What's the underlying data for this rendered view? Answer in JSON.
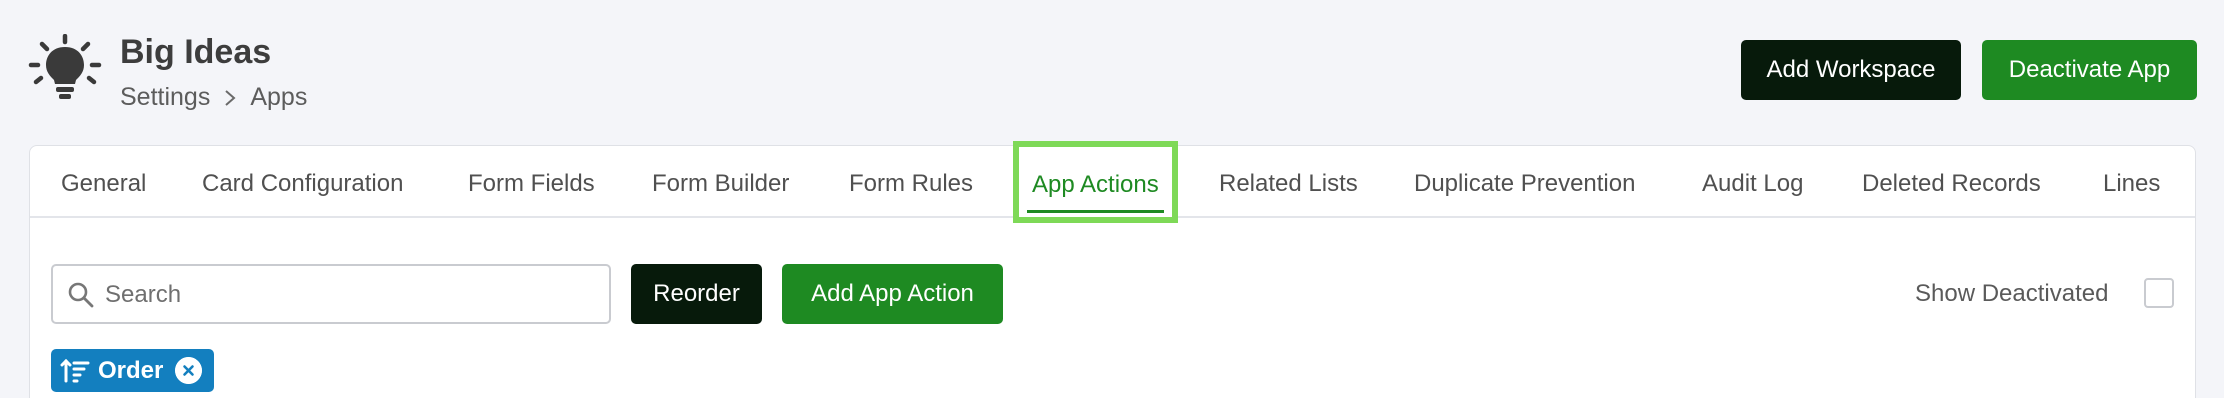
{
  "app": {
    "title": "Big Ideas",
    "icon": "lightbulb-icon"
  },
  "breadcrumb": {
    "items": [
      "Settings",
      "Apps"
    ],
    "separator_icon": "chevron-right-icon"
  },
  "header_actions": {
    "add_workspace_label": "Add Workspace",
    "deactivate_app_label": "Deactivate App"
  },
  "tabs": [
    {
      "label": "General"
    },
    {
      "label": "Card Configuration"
    },
    {
      "label": "Form Fields"
    },
    {
      "label": "Form Builder"
    },
    {
      "label": "Form Rules"
    },
    {
      "label": "App Actions",
      "active": true
    },
    {
      "label": "Related Lists"
    },
    {
      "label": "Duplicate Prevention"
    },
    {
      "label": "Audit Log"
    },
    {
      "label": "Deleted Records"
    },
    {
      "label": "Lines"
    }
  ],
  "toolbar": {
    "search_placeholder": "Search",
    "search_value": "",
    "reorder_label": "Reorder",
    "add_action_label": "Add App Action",
    "show_deactivated_label": "Show Deactivated",
    "show_deactivated_checked": false
  },
  "filter_chip": {
    "label": "Order",
    "icon": "sort-icon",
    "remove_icon": "close-icon"
  },
  "colors": {
    "primary_green": "#1e8a22",
    "dark_button": "#071a0b",
    "chip_blue": "#137fbf",
    "active_tab_highlight": "#7ed957",
    "background": "#f4f5f9"
  }
}
